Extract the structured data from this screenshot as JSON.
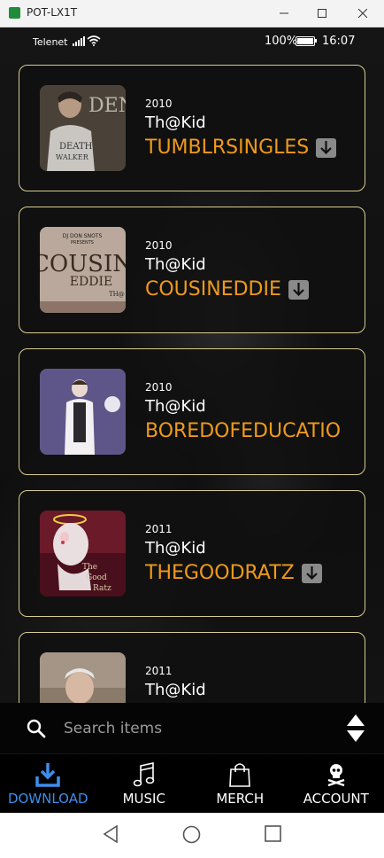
{
  "window": {
    "title": "POT-LX1T"
  },
  "status": {
    "carrier": "Telenet",
    "battery": "100%",
    "time": "16:07"
  },
  "items": [
    {
      "year": "2010",
      "artist": "Th@Kid",
      "album": "TUMBLRSINGLES",
      "download": true
    },
    {
      "year": "2010",
      "artist": "Th@Kid",
      "album": "COUSINEDDIE",
      "download": true
    },
    {
      "year": "2010",
      "artist": "Th@Kid",
      "album": "BOREDOFEDUCATIO",
      "download": false
    },
    {
      "year": "2011",
      "artist": "Th@Kid",
      "album": "THEGOODRATZ",
      "download": true
    },
    {
      "year": "2011",
      "artist": "Th@Kid",
      "album": "",
      "download": false
    }
  ],
  "search": {
    "placeholder": "Search items"
  },
  "tabs": [
    {
      "label": "DOWNLOAD",
      "icon": "download-icon",
      "active": true
    },
    {
      "label": "MUSIC",
      "icon": "music-note-icon",
      "active": false
    },
    {
      "label": "MERCH",
      "icon": "shopping-bag-icon",
      "active": false
    },
    {
      "label": "ACCOUNT",
      "icon": "skull-icon",
      "active": false
    }
  ],
  "colors": {
    "accent": "#f09a1a",
    "active_tab": "#3d8eea",
    "card_border": "#d9cc8e"
  }
}
